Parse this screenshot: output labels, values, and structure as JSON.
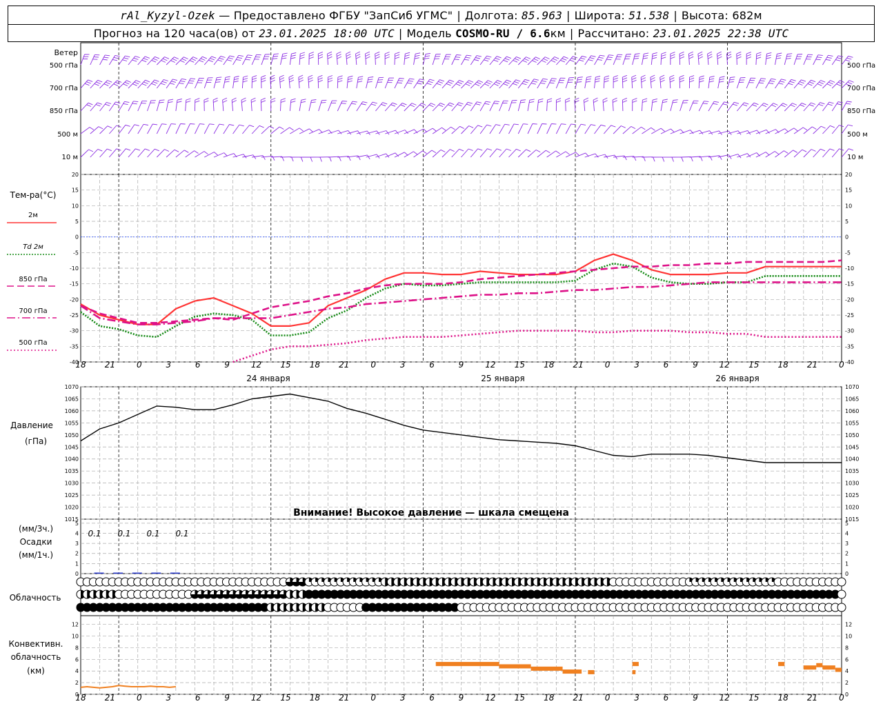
{
  "header": {
    "station": "rAl_Kyzyl-Ozek",
    "provider": "— Предоставлено ФГБУ \"ЗапСиб УГМС\"",
    "lon_label": "Долгота:",
    "lon_value": "85.963",
    "lat_label": "Широта:",
    "lat_value": "51.538",
    "alt_label": "Высота:",
    "alt_value": "682м",
    "forecast_prefix": "Прогноз на 120 часа(ов) от",
    "forecast_start": "23.01.2025 18:00 UTC",
    "model_label": "Модель",
    "model_name": "COSMO-RU / 6.6",
    "model_unit": "км",
    "computed_label": "Рассчитано:",
    "computed_value": "23.01.2025 22:38 UTC"
  },
  "wind_panel": {
    "title": "Ветер",
    "levels": [
      "500 гПа",
      "700 гПа",
      "850 гПа",
      "500 м",
      "10  м"
    ]
  },
  "temp_panel": {
    "title": "Тем-ра(°C)",
    "legend": [
      {
        "label": "2м",
        "color": "#ff3333",
        "style": "solid"
      },
      {
        "label": "Td  2м",
        "color": "#118811",
        "style": "dot"
      },
      {
        "label": "850 гПа",
        "color": "#dd1188",
        "style": "dash"
      },
      {
        "label": "700 гПа",
        "color": "#dd1188",
        "style": "dashdot"
      },
      {
        "label": "500 гПа",
        "color": "#dd1188",
        "style": "dots"
      }
    ],
    "yticks": [
      20,
      15,
      10,
      5,
      0,
      -5,
      -10,
      -15,
      -20,
      -25,
      -30,
      -35,
      -40
    ]
  },
  "time_axis": {
    "hour_labels": [
      "18",
      "21",
      "0",
      "3",
      "6",
      "9",
      "12",
      "15",
      "18",
      "21",
      "0",
      "3",
      "6",
      "9",
      "12",
      "15",
      "18",
      "21",
      "0",
      "3",
      "6",
      "9",
      "12",
      "15",
      "18",
      "21",
      "0"
    ],
    "day_labels": [
      "24 января",
      "25 января",
      "26 января"
    ]
  },
  "pressure_panel": {
    "title": "Давление",
    "unit": "(гПа)",
    "yticks": [
      1070,
      1065,
      1060,
      1055,
      1050,
      1045,
      1040,
      1035,
      1030,
      1025,
      1020,
      1015
    ],
    "warning": "Внимание! Высокое давление — шкала смещена"
  },
  "precip_panel": {
    "unit_top": "(мм/3ч.)",
    "title": "Осадки",
    "unit_bottom": "(мм/1ч.)",
    "yticks": [
      5,
      4,
      3,
      2,
      1,
      0
    ],
    "value_labels": [
      "0.1",
      "0.1",
      "0.1",
      "0.1"
    ]
  },
  "cloud_panel": {
    "title": "Облачность"
  },
  "conv_panel": {
    "title_1": "Конвективн.",
    "title_2": "облачность",
    "unit": "(км)",
    "yticks": [
      12,
      10,
      8,
      6,
      4,
      2,
      0
    ]
  },
  "colors": {
    "wind": "#8a2be2",
    "pressure": "#000000",
    "conv": "#f08020",
    "zero_line": "#3355ff",
    "precip": "#2233cc"
  },
  "chart_data": [
    {
      "type": "line",
      "title": "Тем-ра(°C)",
      "x_unit": "hours from 23.01.2025 18:00 UTC",
      "ylim": [
        -40,
        20
      ],
      "grid": true,
      "x": [
        0,
        3,
        6,
        9,
        12,
        15,
        18,
        21,
        24,
        27,
        30,
        33,
        36,
        39,
        42,
        45,
        48,
        51,
        54,
        57,
        60,
        63,
        66,
        69,
        72,
        75,
        78,
        81,
        84,
        87,
        90,
        93,
        96,
        99,
        102,
        105,
        108,
        111,
        114,
        117,
        120
      ],
      "series": [
        {
          "name": "2м",
          "values": [
            -21.5,
            -25,
            -26.5,
            -28,
            -28,
            -23,
            -20.5,
            -19.5,
            -22,
            -24.5,
            -28.5,
            -28.5,
            -27.5,
            -22,
            -19.5,
            -17,
            -13.5,
            -11.5,
            -11.5,
            -12,
            -12,
            -11,
            -11.5,
            -12,
            -12,
            -12,
            -11,
            -7.5,
            -5.5,
            -7.5,
            -10.5,
            -12,
            -12,
            -12,
            -11.5,
            -11.5,
            -9.5,
            -9.5,
            -9.5,
            -9.5,
            -9.5
          ]
        },
        {
          "name": "Td  2м",
          "values": [
            -24,
            -28.5,
            -29.5,
            -31.5,
            -32,
            -28.5,
            -25.5,
            -24.5,
            -25,
            -26.5,
            -31.5,
            -31.5,
            -30.5,
            -26,
            -23.5,
            -19.5,
            -16.5,
            -15,
            -15.5,
            -15.5,
            -15,
            -14.5,
            -14.5,
            -14.5,
            -14.5,
            -14.5,
            -14,
            -10.5,
            -8.5,
            -9.5,
            -13,
            -14.5,
            -15,
            -15,
            -14.5,
            -14.5,
            -12.5,
            -12.5,
            -12.5,
            -12.5,
            -12.5
          ]
        },
        {
          "name": "850 гПа",
          "values": [
            -22,
            -24.5,
            -26,
            -27.5,
            -27.5,
            -27,
            -26.5,
            -26,
            -26.5,
            -24.5,
            -22.5,
            -21.5,
            -20.5,
            -19,
            -18,
            -16.5,
            -15.5,
            -15,
            -15,
            -15,
            -14.5,
            -13.5,
            -13,
            -12.5,
            -12,
            -11.5,
            -11,
            -10.5,
            -10,
            -9.5,
            -9.5,
            -9,
            -9,
            -8.5,
            -8.5,
            -8,
            -8,
            -8,
            -8,
            -8,
            -7.5
          ]
        },
        {
          "name": "700 гПа",
          "values": [
            -22,
            -26,
            -27,
            -28,
            -28,
            -27.5,
            -27,
            -26,
            -26,
            -26,
            -26,
            -25,
            -24,
            -23,
            -22.5,
            -21.5,
            -21,
            -20.5,
            -20,
            -19.5,
            -19,
            -18.5,
            -18.5,
            -18,
            -18,
            -17.5,
            -17,
            -17,
            -16.5,
            -16,
            -16,
            -15.5,
            -15,
            -14.5,
            -14.5,
            -14.5,
            -14.5,
            -14.5,
            -14.5,
            -14.5,
            -14.5
          ]
        },
        {
          "name": "500 гПа",
          "values": [
            null,
            null,
            null,
            null,
            null,
            null,
            null,
            null,
            -40,
            -38,
            -36,
            -35,
            -35,
            -34.5,
            -34,
            -33,
            -32.5,
            -32,
            -32,
            -32,
            -31.5,
            -31,
            -30.5,
            -30,
            -30,
            -30,
            -30,
            -30.5,
            -30.5,
            -30,
            -30,
            -30,
            -30.5,
            -30.5,
            -31,
            -31,
            -32,
            -32,
            -32,
            -32,
            -32
          ]
        }
      ]
    },
    {
      "type": "line",
      "title": "Давление",
      "x_unit": "hours from 23.01.2025 18:00 UTC",
      "ylim": [
        1015,
        1070
      ],
      "grid": true,
      "x": [
        0,
        3,
        6,
        9,
        12,
        15,
        18,
        21,
        24,
        27,
        30,
        33,
        36,
        39,
        42,
        45,
        48,
        51,
        54,
        57,
        60,
        63,
        66,
        69,
        72,
        75,
        78,
        81,
        84,
        87,
        90,
        93,
        96,
        99,
        102,
        105,
        108,
        111,
        114,
        117,
        120
      ],
      "series": [
        {
          "name": "",
          "values": [
            1047.5,
            1052.5,
            1055,
            1058.5,
            1062,
            1061.5,
            1060.5,
            1060.5,
            1062.5,
            1065,
            1066,
            1067,
            1065.5,
            1064,
            1061,
            1059,
            1056.5,
            1054,
            1052,
            1051,
            1050,
            1049,
            1048,
            1047.5,
            1047,
            1046.5,
            1045.5,
            1043.5,
            1041.5,
            1041,
            1042,
            1042,
            1042,
            1041.5,
            1040.5,
            1039.5,
            1038.5,
            1038.5,
            1038.5,
            1038.5,
            1038.5
          ]
        }
      ]
    },
    {
      "type": "bar",
      "title": "Осадки",
      "x_unit": "hours from 23.01.2025 18:00 UTC",
      "ylim": [
        0,
        5
      ],
      "x": [
        3,
        6,
        9,
        12,
        15
      ],
      "values": [
        0.1,
        0.1,
        0.1,
        0.1,
        0.1
      ]
    },
    {
      "type": "table",
      "title": "Облачность",
      "note": "cloud cover glyphs per 1-hour step, three rows (upper/middle/lower), value 0..8 oktas",
      "rows": [
        {
          "name": "upper",
          "segments": [
            [
              0,
              33,
              0
            ],
            [
              33,
              36,
              6
            ],
            [
              36,
              48,
              2
            ],
            [
              48,
              60,
              4
            ],
            [
              60,
              72,
              4
            ],
            [
              72,
              84,
              4
            ],
            [
              84,
              96,
              0
            ],
            [
              96,
              110,
              2
            ],
            [
              110,
              120,
              0
            ]
          ]
        },
        {
          "name": "middle",
          "segments": [
            [
              0,
              6,
              4
            ],
            [
              6,
              18,
              0
            ],
            [
              18,
              33,
              6
            ],
            [
              33,
              36,
              4
            ],
            [
              36,
              120,
              8
            ]
          ]
        },
        {
          "name": "lower",
          "segments": [
            [
              0,
              30,
              8
            ],
            [
              30,
              39,
              4
            ],
            [
              39,
              45,
              0
            ],
            [
              45,
              60,
              8
            ],
            [
              60,
              120,
              0
            ]
          ]
        }
      ]
    },
    {
      "type": "line",
      "title": "Конвективн. облачность",
      "x_unit": "hours from 23.01.2025 18:00 UTC",
      "ylim": [
        0,
        13
      ],
      "series": [
        {
          "name": "",
          "values": [
            1.2,
            1.3,
            1.2,
            1.1,
            1.2,
            1.3,
            1.5,
            1.4,
            1.3,
            1.3,
            1.3,
            1.4,
            1.3,
            1.3,
            1.2,
            1.3
          ]
        }
      ],
      "segments": [
        {
          "x0": 56,
          "x1": 66,
          "y": 5.2
        },
        {
          "x0": 66,
          "x1": 71,
          "y": 4.8
        },
        {
          "x0": 71,
          "x1": 76,
          "y": 4.4
        },
        {
          "x0": 76,
          "x1": 79,
          "y": 3.9
        },
        {
          "x0": 80,
          "x1": 81,
          "y": 3.8
        },
        {
          "x0": 87,
          "x1": 87.5,
          "y": 3.8
        },
        {
          "x0": 87,
          "x1": 88,
          "y": 5.2
        },
        {
          "x0": 110,
          "x1": 111,
          "y": 5.2
        },
        {
          "x0": 114,
          "x1": 116,
          "y": 4.6
        },
        {
          "x0": 116,
          "x1": 117,
          "y": 5.0
        },
        {
          "x0": 117,
          "x1": 119,
          "y": 4.6
        },
        {
          "x0": 119,
          "x1": 120,
          "y": 4.2
        }
      ]
    }
  ]
}
